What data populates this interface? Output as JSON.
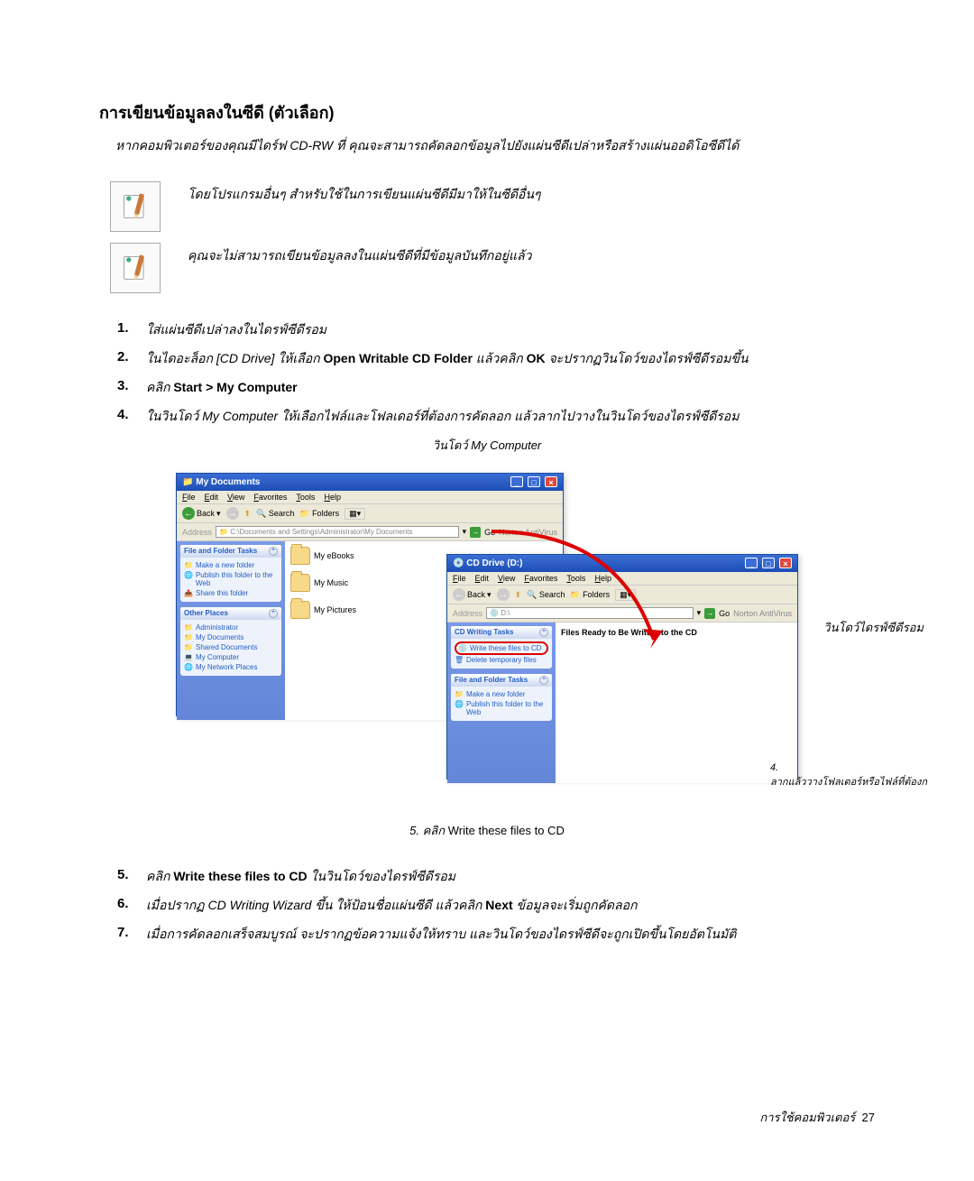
{
  "title": "การเขียนข้อมูลลงในซีดี (ตัวเลือก)",
  "intro": "หากคอมพิวเตอร์ของคุณมีไดร์ฟ CD-RW ที่ คุณจะสามารถคัดลอกข้อมูลไปยังแผ่นซีดีเปล่าหรือสร้างแผ่นออดิโอซีดีได้",
  "note1": "โดยโปรแกรมอื่นๆ สำหรับใช้ในการเขียนแผ่นซีดีมีมาให้ในซีดีอื่นๆ",
  "note2": "คุณจะไม่สามารถเขียนข้อมูลลงในแผ่นซีดีที่มีข้อมูลบันทึกอยู่แล้ว",
  "steps": [
    {
      "n": "1.",
      "text_a": "ใส่แผ่นซีดีเปล่าลงในไดรฟ์ซีดีรอม",
      "text_b": ""
    },
    {
      "n": "2.",
      "text_a": "ในไดอะล็อก [CD Drive] ให้เลือก ",
      "bold1": "Open Writable CD Folder",
      "text_b": " แล้วคลิก ",
      "bold2": "OK",
      "text_c": " จะปรากฏวินโดว์ของไดรฟ์ซีดีรอมขึ้น"
    },
    {
      "n": "3.",
      "text_a": "คลิก ",
      "bold1": "Start > My Computer",
      "text_b": ""
    },
    {
      "n": "4.",
      "text_a": "ในวินโดว์ ",
      "ital1": "My Computer",
      "text_b": " ให้เลือกไฟล์และโฟลเดอร์ที่ต้องการคัดลอก แล้วลากไปวางในวินโดว์ของไดรฟ์ซีดีรอม"
    }
  ],
  "fig1_caption": "วินโดว์ My Computer",
  "fig2_caption": "วินโดว์ไดรฟ์ซีดีรอม",
  "win1": {
    "title": "My Documents",
    "menu": [
      "File",
      "Edit",
      "View",
      "Favorites",
      "Tools",
      "Help"
    ],
    "back": "Back",
    "search": "Search",
    "folders": "Folders",
    "address_label": "Address",
    "address": "C:\\Documents and Settings\\Administrator\\My Documents",
    "go": "Go",
    "norton": "Norton AntiVirus",
    "task1_head": "File and Folder Tasks",
    "task1_items": [
      "Make a new folder",
      "Publish this folder to the Web",
      "Share this folder"
    ],
    "task2_head": "Other Places",
    "task2_items": [
      "Administrator",
      "My Documents",
      "Shared Documents",
      "My Computer",
      "My Network Places"
    ],
    "folders_list": [
      "My eBooks",
      "My Music",
      "My Pictures"
    ]
  },
  "win2": {
    "title": "CD Drive (D:)",
    "menu": [
      "File",
      "Edit",
      "View",
      "Favorites",
      "Tools",
      "Help"
    ],
    "back": "Back",
    "search": "Search",
    "folders": "Folders",
    "address_label": "Address",
    "address": "D:\\",
    "go": "Go",
    "norton": "Norton AntiVirus",
    "task0_head": "CD Writing Tasks",
    "task0_items": [
      "Write these files to CD",
      "Delete temporary files"
    ],
    "task1_head": "File and Folder Tasks",
    "task1_items": [
      "Make a new folder",
      "Publish this folder to the Web"
    ],
    "files_ready": "Files Ready to Be Written to the CD"
  },
  "annot4_num": "4.",
  "annot4_text": "ลากแล้ววางโฟลเดอร์หรือไฟล์ที่ต้องก",
  "fig_bottom_caption_a": "5. คลิก ",
  "fig_bottom_caption_b": "Write these files to CD",
  "steps2": [
    {
      "n": "5.",
      "text_a": "คลิก ",
      "bold1": "Write these files to CD",
      "text_b": " ในวินโดว์ของไดรฟ์ซีดีรอม"
    },
    {
      "n": "6.",
      "text_a": "เมื่อปรากฏ ",
      "ital1": "CD Writing Wizard",
      "text_b": " ขึ้น ให้ป้อนชื่อแผ่นซีดี แล้วคลิก ",
      "bold1": "Next",
      "text_c": " ข้อมูลจะเริ่มถูกคัดลอก"
    },
    {
      "n": "7.",
      "text_a": "เมื่อการคัดลอกเสร็จสมบูรณ์ จะปรากฏข้อความแจ้งให้ทราบ และวินโดว์ของไดรฟ์ซีดีจะถูกเปิดขึ้นโดยอัตโนมัติ"
    }
  ],
  "footer_label": "การใช้คอมพิวเตอร์",
  "footer_page": "27"
}
